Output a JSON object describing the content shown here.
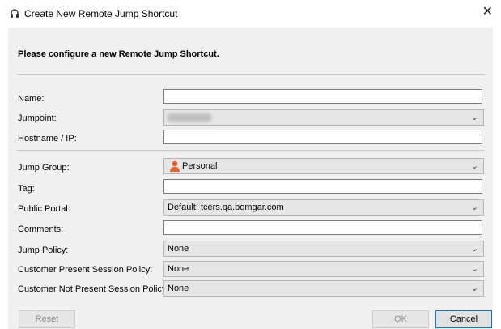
{
  "window": {
    "title": "Create New Remote Jump Shortcut",
    "close_glyph": "✕",
    "app_icon": "headset-icon"
  },
  "form": {
    "heading": "Please configure a new Remote Jump Shortcut.",
    "name": {
      "label": "Name:",
      "value": ""
    },
    "jumpoint": {
      "label": "Jumpoint:",
      "value": ""
    },
    "hostname": {
      "label": "Hostname / IP:",
      "value": ""
    },
    "jump_group": {
      "label": "Jump Group:",
      "value": "Personal",
      "icon": "person-icon"
    },
    "tag": {
      "label": "Tag:",
      "value": ""
    },
    "public_portal": {
      "label": "Public Portal:",
      "value": "Default: tcers.qa.bomgar.com"
    },
    "comments": {
      "label": "Comments:",
      "value": ""
    },
    "jump_policy": {
      "label": "Jump Policy:",
      "value": "None"
    },
    "customer_present_policy": {
      "label": "Customer Present Session Policy:",
      "value": "None"
    },
    "customer_not_present_policy": {
      "label": "Customer Not Present Session Policy:",
      "value": "None"
    }
  },
  "buttons": {
    "reset": "Reset",
    "ok": "OK",
    "cancel": "Cancel"
  },
  "dropdown_chevron": "⌄"
}
